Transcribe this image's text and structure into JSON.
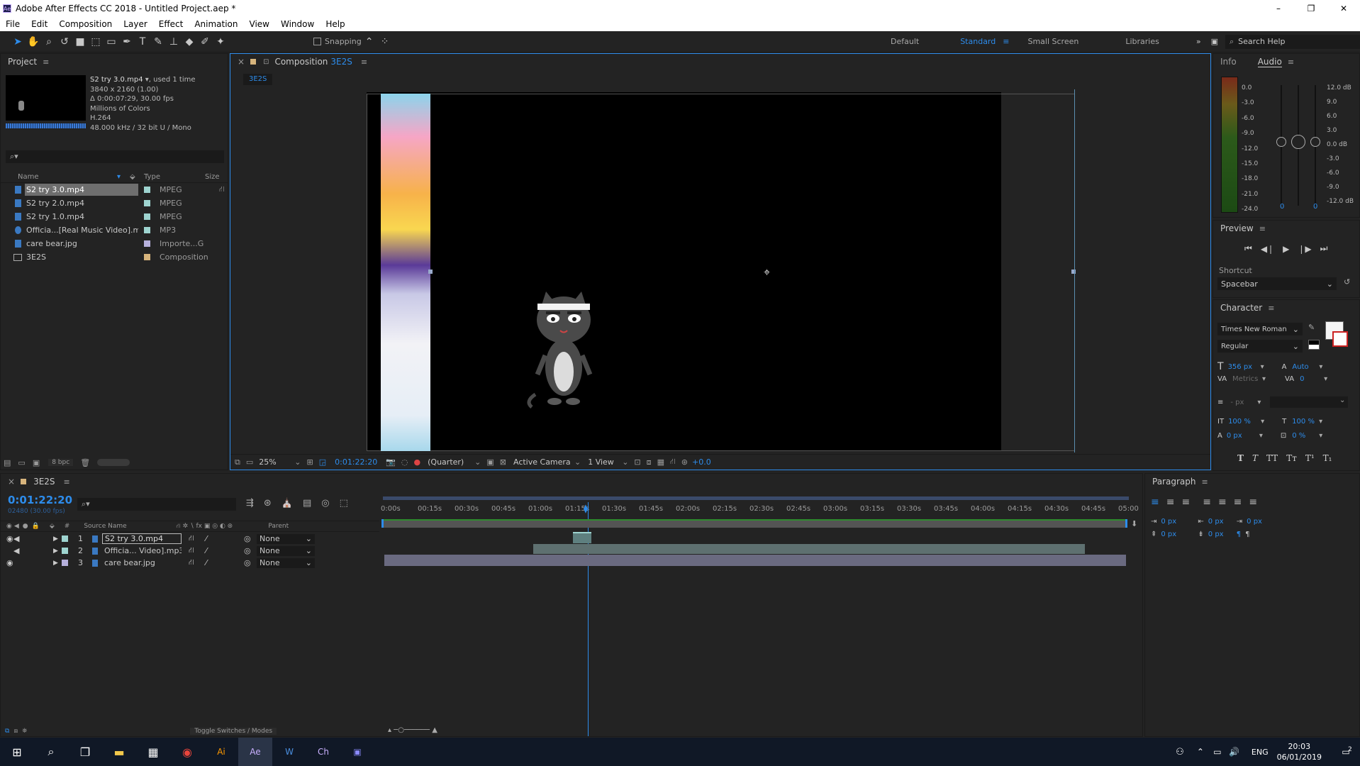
{
  "window": {
    "title": "Adobe After Effects CC 2018 - Untitled Project.aep *",
    "controls": [
      "–",
      "❐",
      "✕"
    ]
  },
  "menu": [
    "File",
    "Edit",
    "Composition",
    "Layer",
    "Effect",
    "Animation",
    "View",
    "Window",
    "Help"
  ],
  "toolbar": {
    "snapping": "Snapping",
    "workspaces": [
      "Default",
      "Standard",
      "Small Screen",
      "Libraries"
    ],
    "search_placeholder": "Search Help"
  },
  "project": {
    "title": "Project",
    "selected": {
      "name": "S2 try 3.0.mp4",
      "used": ", used 1 time",
      "resolution": "3840 x 2160 (1.00)",
      "duration": "Δ 0:00:07:29, 30.00 fps",
      "colors": "Millions of Colors",
      "codec": "H.264",
      "audio": "48.000 kHz / 32 bit U / Mono"
    },
    "columns": {
      "name": "Name",
      "type": "Type",
      "size": "Size"
    },
    "items": [
      {
        "name": "S2 try 3.0.mp4",
        "type": "MPEG",
        "color": "#9ed4d0"
      },
      {
        "name": "S2 try 2.0.mp4",
        "type": "MPEG",
        "color": "#9ed4d0"
      },
      {
        "name": "S2 try 1.0.mp4",
        "type": "MPEG",
        "color": "#9ed4d0"
      },
      {
        "name": "Officia...[Real Music Video].mp3",
        "type": "MP3",
        "color": "#9ed4d0"
      },
      {
        "name": "care bear.jpg",
        "type": "Importe...G",
        "color": "#b6b0dc"
      },
      {
        "name": "3E2S",
        "type": "Composition",
        "color": "#d7b47c"
      }
    ],
    "bpc": "8 bpc"
  },
  "composition": {
    "tab_label": "Composition",
    "name": "3E2S",
    "zoom": "25%",
    "timecode": "0:01:22:20",
    "resolution": "(Quarter)",
    "camera": "Active Camera",
    "views": "1 View",
    "exposure": "+0.0"
  },
  "info": {
    "tabs": [
      "Info",
      "Audio"
    ],
    "meter_left": [
      "0.0",
      "-3.0",
      "-6.0",
      "-9.0",
      "-12.0",
      "-15.0",
      "-18.0",
      "-21.0",
      "-24.0"
    ],
    "meter_right": [
      "12.0 dB",
      "9.0",
      "6.0",
      "3.0",
      "0.0 dB",
      "-3.0",
      "-6.0",
      "-9.0",
      "-12.0 dB"
    ],
    "values": [
      "0",
      "0"
    ]
  },
  "preview": {
    "title": "Preview",
    "shortcut_label": "Shortcut",
    "shortcut": "Spacebar"
  },
  "character": {
    "title": "Character",
    "font": "Times New Roman",
    "style": "Regular",
    "size": "356 px",
    "leading": "Auto",
    "kerning": "Metrics",
    "tracking": "0",
    "stroke": "- px",
    "vscale": "100 %",
    "hscale": "100 %",
    "baseline": "0 px",
    "tsume": "0 %"
  },
  "paragraph": {
    "title": "Paragraph",
    "indents": [
      "0 px",
      "0 px",
      "0 px",
      "0 px",
      "0 px"
    ]
  },
  "timeline": {
    "comp": "3E2S",
    "timecode": "0:01:22:20",
    "frames": "02480 (30.00 fps)",
    "source_name": "Source Name",
    "parent": "Parent",
    "toggle": "Toggle Switches / Modes",
    "ticks": [
      "0:00s",
      "00:15s",
      "00:30s",
      "00:45s",
      "01:00s",
      "01:15s",
      "01:30s",
      "01:45s",
      "02:00s",
      "02:15s",
      "02:30s",
      "02:45s",
      "03:00s",
      "03:15s",
      "03:30s",
      "03:45s",
      "04:00s",
      "04:15s",
      "04:30s",
      "04:45s",
      "05:00"
    ],
    "layers": [
      {
        "num": "1",
        "name": "S2 try 3.0.mp4",
        "parent": "None",
        "color": "#9ed4d0"
      },
      {
        "num": "2",
        "name": "Officia... Video].mp3",
        "parent": "None",
        "color": "#9ed4d0"
      },
      {
        "num": "3",
        "name": "care bear.jpg",
        "parent": "None",
        "color": "#b6b0dc"
      }
    ]
  },
  "taskbar": {
    "lang": "ENG",
    "time": "20:03",
    "date": "06/01/2019",
    "notif": "2"
  }
}
